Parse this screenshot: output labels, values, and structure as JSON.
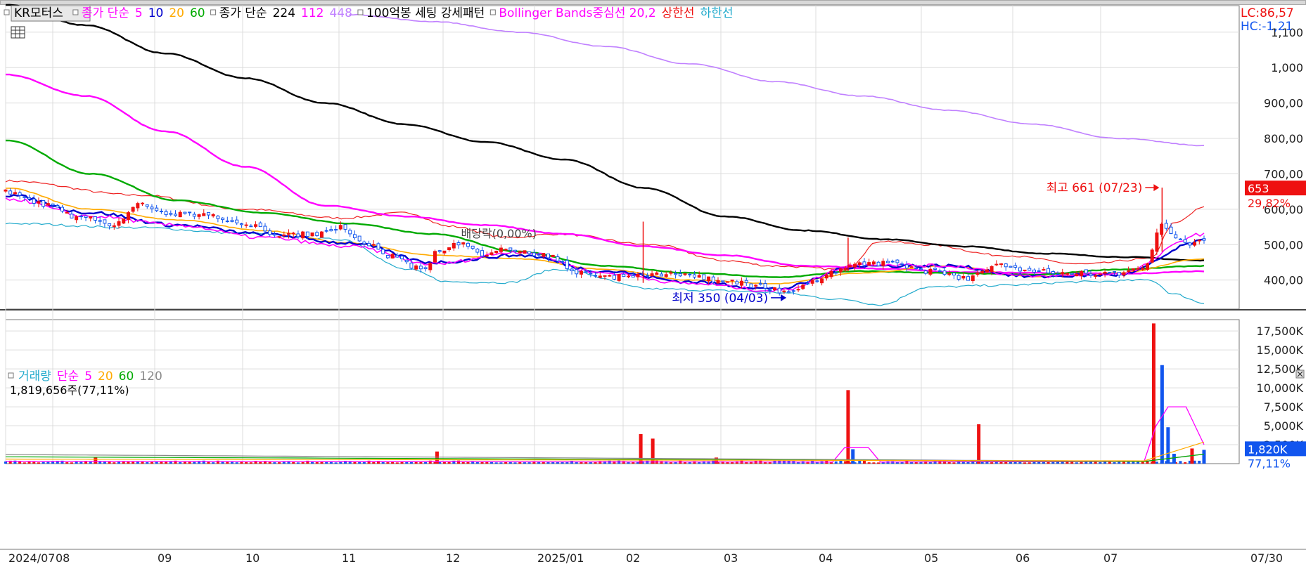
{
  "stock_name": "KR모터스",
  "legend_price": {
    "ma": {
      "label": "종가 단순",
      "periods": [
        "5",
        "10",
        "20",
        "60"
      ],
      "colors": [
        "#ff00ff",
        "#0000cc",
        "#ffaa00",
        "#00aa00"
      ]
    },
    "ma_long": {
      "label": "종가 단순",
      "periods": [
        "224",
        "112",
        "448"
      ],
      "colors": [
        "#000000",
        "#ff00ff",
        "#c080ff"
      ]
    },
    "pattern": "100억봉 세팅 강세패턴",
    "bollinger": {
      "label": "Bollinger Bands중심선 20,2",
      "upper": "상한선",
      "lower": "하한선"
    }
  },
  "legend_volume": {
    "label": "거래량",
    "ma_label": "단순",
    "periods": [
      "5",
      "20",
      "60",
      "120"
    ],
    "colors": [
      "#ff00ff",
      "#ffaa00",
      "#00aa00",
      "#888888"
    ]
  },
  "volume_info": "1,819,656주(77,11%)",
  "right_info": {
    "lc": "LC:86,57",
    "hc": "HC:-1,21"
  },
  "current_price": {
    "value": "653",
    "change": "29,82%"
  },
  "current_volume": {
    "value": "1,820K",
    "pct": "77,11%"
  },
  "annotations": {
    "high": "최고 661 (07/23)",
    "low": "최저 350 (04/03)",
    "dividend": "배당락(0,00%)"
  },
  "x_axis": {
    "labels": [
      "2024/07",
      "08",
      "09",
      "10",
      "11",
      "12",
      "2025/01",
      "02",
      "03",
      "04",
      "05",
      "06",
      "07"
    ],
    "last_label": "07/30"
  },
  "chart_data": {
    "type": "candlestick",
    "price_axis": {
      "tick_labels": [
        "1,100",
        "1,000",
        "900,00",
        "800,00",
        "700,00",
        "600,00",
        "500,00",
        "400,00"
      ],
      "tick_values": [
        1100,
        1000,
        900,
        800,
        700,
        600,
        500,
        400
      ],
      "range": [
        318,
        1175
      ]
    },
    "volume_axis": {
      "tick_labels": [
        "17,500K",
        "15,000K",
        "12,500K",
        "10,000K",
        "7,500K",
        "5,000K",
        "2,500K"
      ],
      "tick_values": [
        17500,
        15000,
        12500,
        10000,
        7500,
        5000,
        2500
      ],
      "range": [
        0,
        19000
      ]
    },
    "period": {
      "start": "2024/07",
      "end": "07/30"
    },
    "price_high": 661,
    "price_low": 350,
    "last_close": 653,
    "bollinger_anchors": [
      {
        "t": 0,
        "upper": 680,
        "lower": 560
      },
      {
        "t": 0.11,
        "upper": 640,
        "lower": 548
      },
      {
        "t": 0.2,
        "upper": 600,
        "lower": 532
      },
      {
        "t": 0.28,
        "upper": 575,
        "lower": 515
      },
      {
        "t": 0.335,
        "upper": 590,
        "lower": 430
      },
      {
        "t": 0.37,
        "upper": 552,
        "lower": 395
      },
      {
        "t": 0.42,
        "upper": 520,
        "lower": 393
      },
      {
        "t": 0.46,
        "upper": 530,
        "lower": 430
      },
      {
        "t": 0.54,
        "upper": 500,
        "lower": 375
      },
      {
        "t": 0.6,
        "upper": 455,
        "lower": 370
      },
      {
        "t": 0.64,
        "upper": 440,
        "lower": 365
      },
      {
        "t": 0.7,
        "upper": 430,
        "lower": 345
      },
      {
        "t": 0.73,
        "upper": 510,
        "lower": 330
      },
      {
        "t": 0.77,
        "upper": 500,
        "lower": 380
      },
      {
        "t": 0.83,
        "upper": 470,
        "lower": 385
      },
      {
        "t": 0.9,
        "upper": 445,
        "lower": 395
      },
      {
        "t": 0.955,
        "upper": 460,
        "lower": 400
      },
      {
        "t": 0.975,
        "upper": 560,
        "lower": 360
      },
      {
        "t": 1.0,
        "upper": 605,
        "lower": 335
      }
    ],
    "price_anchors": [
      {
        "t": 0,
        "v": 648
      },
      {
        "t": 0.03,
        "v": 615
      },
      {
        "t": 0.06,
        "v": 578
      },
      {
        "t": 0.09,
        "v": 558
      },
      {
        "t": 0.11,
        "v": 612
      },
      {
        "t": 0.14,
        "v": 585
      },
      {
        "t": 0.17,
        "v": 582
      },
      {
        "t": 0.2,
        "v": 560
      },
      {
        "t": 0.23,
        "v": 528
      },
      {
        "t": 0.26,
        "v": 530
      },
      {
        "t": 0.28,
        "v": 548
      },
      {
        "t": 0.3,
        "v": 505
      },
      {
        "t": 0.32,
        "v": 468
      },
      {
        "t": 0.35,
        "v": 428
      },
      {
        "t": 0.36,
        "v": 480
      },
      {
        "t": 0.38,
        "v": 505
      },
      {
        "t": 0.4,
        "v": 470
      },
      {
        "t": 0.42,
        "v": 488
      },
      {
        "t": 0.45,
        "v": 470
      },
      {
        "t": 0.48,
        "v": 420
      },
      {
        "t": 0.5,
        "v": 408
      },
      {
        "t": 0.53,
        "v": 412
      },
      {
        "t": 0.56,
        "v": 418
      },
      {
        "t": 0.6,
        "v": 398
      },
      {
        "t": 0.63,
        "v": 382
      },
      {
        "t": 0.655,
        "v": 360
      },
      {
        "t": 0.67,
        "v": 395
      },
      {
        "t": 0.69,
        "v": 420
      },
      {
        "t": 0.71,
        "v": 445
      },
      {
        "t": 0.74,
        "v": 448
      },
      {
        "t": 0.77,
        "v": 425
      },
      {
        "t": 0.8,
        "v": 405
      },
      {
        "t": 0.83,
        "v": 440
      },
      {
        "t": 0.86,
        "v": 425
      },
      {
        "t": 0.89,
        "v": 418
      },
      {
        "t": 0.93,
        "v": 418
      },
      {
        "t": 0.95,
        "v": 432
      },
      {
        "t": 0.965,
        "v": 560
      },
      {
        "t": 0.975,
        "v": 525
      },
      {
        "t": 0.99,
        "v": 500
      },
      {
        "t": 1.0,
        "v": 512
      }
    ],
    "series": [
      {
        "name": "224",
        "color": "#000000",
        "values": [
          1178,
          1120,
          1040,
          970,
          900,
          840,
          790,
          740,
          660,
          580,
          540,
          515,
          495,
          475,
          465,
          455
        ]
      },
      {
        "name": "448",
        "color": "#c080ff",
        "values": [
          null,
          null,
          null,
          null,
          1150,
          1130,
          1100,
          1060,
          1010,
          960,
          920,
          880,
          840,
          800,
          780
        ]
      },
      {
        "name": "112",
        "color": "#ff00ff",
        "values": [
          980,
          920,
          820,
          720,
          610,
          580,
          555,
          530,
          495,
          470,
          440,
          432,
          422,
          420,
          418,
          425
        ]
      },
      {
        "name": "60",
        "color": "#00aa00",
        "values": [
          795,
          700,
          625,
          590,
          560,
          530,
          480,
          440,
          420,
          408,
          425,
          420,
          415,
          430,
          440
        ]
      },
      {
        "name": "20",
        "color": "#ffaa00",
        "values": [
          660,
          600,
          570,
          540,
          505,
          470,
          460,
          430,
          400,
          390,
          420,
          440,
          410,
          420,
          460
        ]
      },
      {
        "name": "10",
        "color": "#0000cc",
        "values": [
          640,
          590,
          555,
          530,
          505,
          450,
          470,
          425,
          395,
          375,
          440,
          440,
          410,
          415,
          510
        ]
      },
      {
        "name": "5",
        "color": "#ff00ff",
        "values": [
          630,
          580,
          555,
          520,
          495,
          445,
          480,
          420,
          390,
          370,
          445,
          440,
          410,
          418,
          530
        ]
      }
    ],
    "volume_spikes": [
      {
        "t": 0.075,
        "v": 800,
        "up": true
      },
      {
        "t": 0.36,
        "v": 1600,
        "up": true
      },
      {
        "t": 0.53,
        "v": 3900,
        "up": true
      },
      {
        "t": 0.54,
        "v": 3300,
        "up": true
      },
      {
        "t": 0.593,
        "v": 800,
        "up": true
      },
      {
        "t": 0.703,
        "v": 9700,
        "up": true
      },
      {
        "t": 0.707,
        "v": 1900,
        "up": false
      },
      {
        "t": 0.812,
        "v": 5200,
        "up": true
      },
      {
        "t": 0.958,
        "v": 18500,
        "up": true
      },
      {
        "t": 0.965,
        "v": 13000,
        "up": false
      },
      {
        "t": 0.97,
        "v": 4800,
        "up": false
      },
      {
        "t": 0.975,
        "v": 1300,
        "up": false
      },
      {
        "t": 0.99,
        "v": 2000,
        "up": true
      },
      {
        "t": 1.0,
        "v": 1820,
        "up": false
      }
    ],
    "volume_ma5": [
      {
        "t": 0.69,
        "v": 200
      },
      {
        "t": 0.7,
        "v": 2100
      },
      {
        "t": 0.72,
        "v": 2100
      },
      {
        "t": 0.73,
        "v": 200
      },
      {
        "t": 0.95,
        "v": 300
      },
      {
        "t": 0.96,
        "v": 5000
      },
      {
        "t": 0.97,
        "v": 7500
      },
      {
        "t": 0.985,
        "v": 7500
      },
      {
        "t": 1.0,
        "v": 2500
      }
    ]
  }
}
